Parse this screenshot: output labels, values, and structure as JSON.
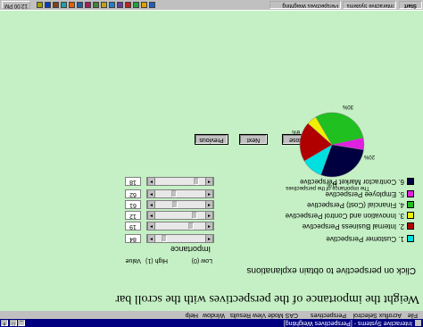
{
  "window": {
    "title": "Interactive Systems - [Perspectives Weighting]",
    "menu": [
      "File",
      "Acroflux Selectrol",
      "Perspectives",
      "CAS Mode",
      "View Results",
      "Window",
      "Help"
    ]
  },
  "main": {
    "heading": "Weight the importance of the perspectives with the scroll bar",
    "hint": "Click on perspective to obtain explanations",
    "scale": {
      "low": "Low (0)",
      "high": "High (1)",
      "value": "Value",
      "label": "Importance"
    },
    "perspectives": [
      {
        "label": "1. Customer Perspective",
        "color": "#00e0e0",
        "value": "84",
        "level": 0.82
      },
      {
        "label": "2. Internal Business Perspective",
        "color": "#b00000",
        "value": "19",
        "level": 0.25
      },
      {
        "label": "3. Innovation and Control Perspective",
        "color": "#f0f000",
        "value": "12",
        "level": 0.18
      },
      {
        "label": "4. Financial (Cost) Perspective",
        "color": "#20c020",
        "value": "61",
        "level": 0.6
      },
      {
        "label": "5. Employee Perspective",
        "color": "#e020e0",
        "value": "62",
        "level": 0.62
      },
      {
        "label": "6. Contractor Market Perspective",
        "color": "#000040",
        "value": "18",
        "level": 0.14
      }
    ],
    "buttons": {
      "previous": "Previous",
      "next": "Next",
      "close": "Close"
    }
  },
  "chart_data": {
    "type": "pie",
    "title": "",
    "subtitle": "The importance of the perspectives",
    "slices": [
      {
        "name": "1. Customer Perspective",
        "value": 11,
        "color": "#00e0e0"
      },
      {
        "name": "2. Internal Business Perspective",
        "value": 20,
        "color": "#b00000"
      },
      {
        "name": "3. Innovation and Control Perspective",
        "value": 5,
        "color": "#f0f000"
      },
      {
        "name": "4. Financial (Cost) Perspective",
        "value": 30,
        "color": "#20c020"
      },
      {
        "name": "5. Employee Perspective",
        "value": 6,
        "color": "#e020e0"
      },
      {
        "name": "6. Contractor Market Perspective",
        "value": 28,
        "color": "#000040"
      }
    ],
    "labels": [
      "11%",
      "20%",
      "30%",
      "6%"
    ]
  },
  "taskbar": {
    "start": "Start",
    "clock": "12:00 PM",
    "tasks": [
      "Interactive Systems",
      "Perspectives Weighting"
    ],
    "icon_colors": [
      "#2060c0",
      "#e0a000",
      "#20a040",
      "#c02020",
      "#6040a0",
      "#2080c0",
      "#c0a020",
      "#408040",
      "#a02060",
      "#2060a0",
      "#e06000",
      "#20a0a0",
      "#804020",
      "#0040c0",
      "#a0a000"
    ]
  }
}
